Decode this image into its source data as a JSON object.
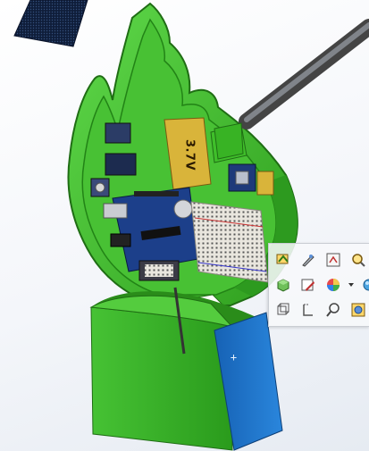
{
  "model": {
    "board_label": "3.7V",
    "colors": {
      "enclosure_green": "#3fbf2a",
      "enclosure_dark": "#1f7e12",
      "base_blue": "#1e73c8",
      "board_blue": "#1c3f8a",
      "battery_gold": "#d9b43a"
    }
  },
  "toolbar": {
    "rows": [
      [
        {
          "icon": "smart-dimension-icon"
        },
        {
          "icon": "edit-tool-icon"
        },
        {
          "icon": "sketch-icon"
        },
        {
          "icon": "magnifier-icon"
        }
      ],
      [
        {
          "icon": "view-orientation-icon"
        },
        {
          "icon": "edit-sketch-icon"
        },
        {
          "icon": "appearance-icon"
        },
        {
          "icon": "dropdown-arrow-icon"
        },
        {
          "icon": "display-style-icon"
        }
      ],
      [
        {
          "icon": "view-cube-icon"
        },
        {
          "icon": "section-view-icon"
        },
        {
          "icon": "zoom-icon"
        },
        {
          "icon": "hide-show-icon"
        }
      ]
    ]
  },
  "cursor": {
    "glyph": "+"
  }
}
